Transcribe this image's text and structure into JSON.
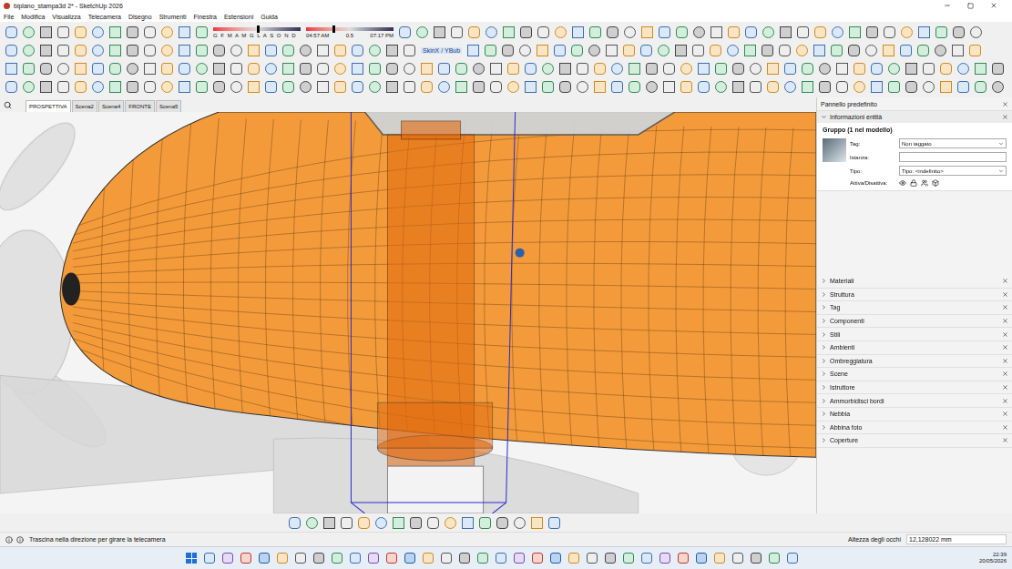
{
  "window": {
    "title": "biplano_stampa3d 2* - SketchUp 2026"
  },
  "menu": [
    "File",
    "Modifica",
    "Visualizza",
    "Telecamera",
    "Disegno",
    "Strumenti",
    "Finestra",
    "Estensioni",
    "Guida"
  ],
  "shadow": {
    "months": "G F M A M G L A S O N D",
    "date_level": 0.5,
    "time_start": "04:57 AM",
    "midday": "0.5",
    "time_end": "07:17 PM",
    "time_level": 0.3
  },
  "toolbar_label": "SkinX / YBub",
  "scene_tabs": [
    {
      "label": "PROSPETTIVA",
      "selected": true
    },
    {
      "label": "Scena2",
      "selected": false
    },
    {
      "label": "Scena4",
      "selected": false
    },
    {
      "label": "FRONTE",
      "selected": false
    },
    {
      "label": "Scena5",
      "selected": false
    }
  ],
  "panel": {
    "title": "Pannello predefinito",
    "entity": {
      "title": "Informazioni entità",
      "expanded": true,
      "heading": "Gruppo (1 nel modello)",
      "fields": [
        {
          "label": "Tag:",
          "value": "Non taggato",
          "kind": "select"
        },
        {
          "label": "Istanza:",
          "value": "",
          "kind": "input"
        },
        {
          "label": "Tipo:",
          "value": "Tipo: <indefinito>",
          "kind": "select"
        }
      ],
      "toggle_label": "Attiva/Disattiva:"
    },
    "sections": [
      {
        "label": "Materiali",
        "expanded": false
      },
      {
        "label": "Struttura",
        "expanded": false
      },
      {
        "label": "Tag",
        "expanded": false
      },
      {
        "label": "Componenti",
        "expanded": false
      },
      {
        "label": "Stili",
        "expanded": false
      },
      {
        "label": "Ambienti",
        "expanded": false
      },
      {
        "label": "Ombreggiatura",
        "expanded": false
      },
      {
        "label": "Scene",
        "expanded": false
      },
      {
        "label": "Istruttore",
        "expanded": false
      },
      {
        "label": "Ammorbidisci bordi",
        "expanded": false
      },
      {
        "label": "Nebbia",
        "expanded": false
      },
      {
        "label": "Abbina foto",
        "expanded": false
      },
      {
        "label": "Coperture",
        "expanded": false
      }
    ]
  },
  "status": {
    "message": "Trascina nella direzione per girare la telecamera",
    "measure_label": "Altezza degli occhi",
    "measure_value": "12,128022 mm"
  },
  "taskbar": {
    "time": "22:39",
    "date": "20/05/2026"
  }
}
